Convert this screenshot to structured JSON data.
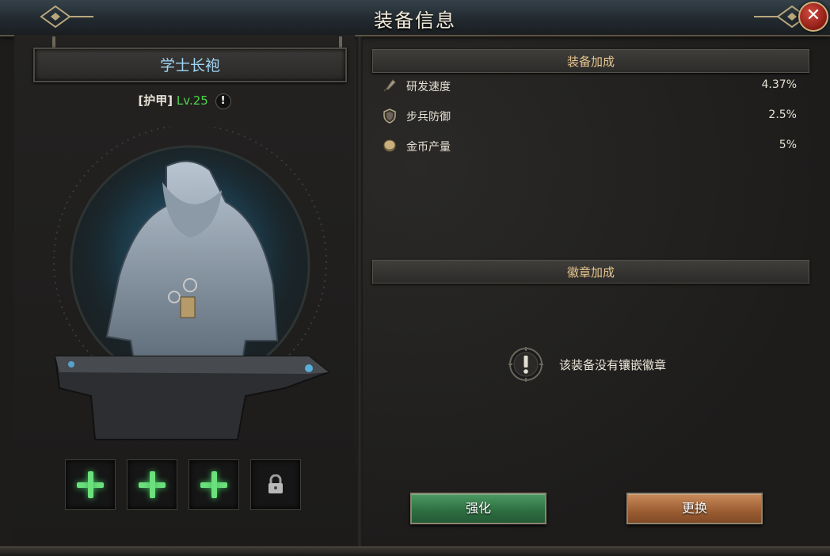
{
  "window": {
    "title": "装备信息",
    "close_label": "✕"
  },
  "item": {
    "name": "学士长袍",
    "type_label": "[护甲]",
    "level_label": "Lv.25",
    "info_mark": "!",
    "slots": [
      {
        "state": "add",
        "icon": "plus-icon"
      },
      {
        "state": "add",
        "icon": "plus-icon"
      },
      {
        "state": "add",
        "icon": "plus-icon"
      },
      {
        "state": "locked",
        "icon": "lock-icon"
      }
    ]
  },
  "equipment_bonus": {
    "header": "装备加成",
    "stats": [
      {
        "icon": "research-quill-icon",
        "label": "研发速度",
        "value": "4.37%"
      },
      {
        "icon": "shield-icon",
        "label": "步兵防御",
        "value": "2.5%"
      },
      {
        "icon": "coin-icon",
        "label": "金币产量",
        "value": "5%"
      }
    ]
  },
  "badge_bonus": {
    "header": "徽章加成",
    "empty_text": "该装备没有镶嵌徽章"
  },
  "buttons": {
    "enhance": "强化",
    "replace": "更换"
  },
  "colors": {
    "item_name": "#9fd5f5",
    "level": "#4fd44a",
    "section_header_text": "#e8c68e",
    "enhance_button": "#2d6d40",
    "replace_button": "#9b5d32"
  }
}
